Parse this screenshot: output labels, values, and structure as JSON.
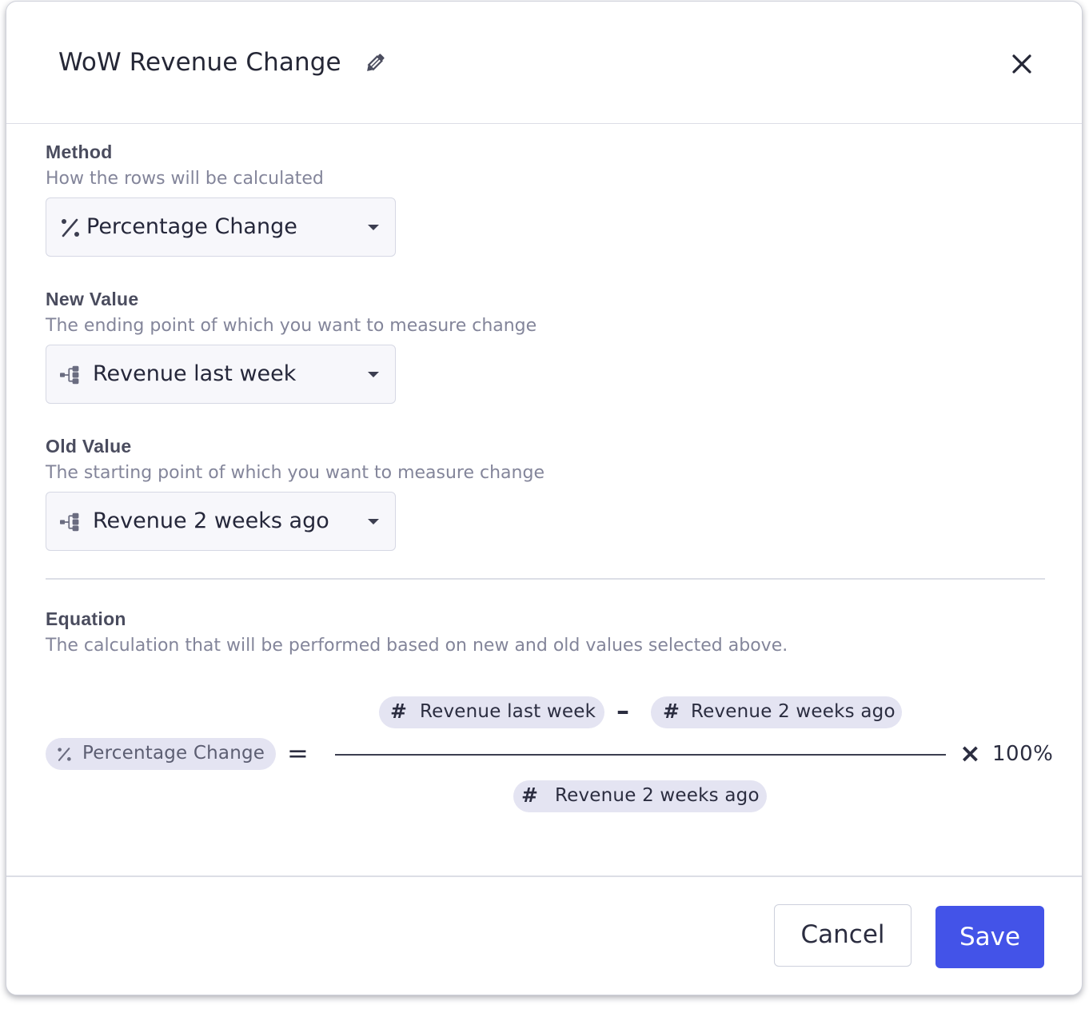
{
  "dialog": {
    "title": "WoW Revenue Change",
    "edit_icon": "pencil-icon",
    "close_icon": "close-icon"
  },
  "method": {
    "label": "Method",
    "description": "How the rows will be calculated",
    "selected": "Percentage Change",
    "icon": "percent-icon"
  },
  "new_value": {
    "label": "New Value",
    "description": "The ending point of which you want to measure change",
    "selected": "Revenue last week",
    "icon": "metric-tree-icon"
  },
  "old_value": {
    "label": "Old Value",
    "description": "The starting point of which you want to measure change",
    "selected": "Revenue 2 weeks ago",
    "icon": "metric-tree-icon"
  },
  "equation": {
    "label": "Equation",
    "description": "The calculation that will be performed based on new and old values selected above.",
    "result_chip": "Percentage Change",
    "equals": "=",
    "numerator_left": "Revenue last week",
    "minus": "–",
    "numerator_right": "Revenue 2 weeks ago",
    "denominator": "Revenue 2 weeks ago",
    "times": "×",
    "multiplier": "100%",
    "number_icon": "#"
  },
  "footer": {
    "cancel_label": "Cancel",
    "save_label": "Save"
  },
  "colors": {
    "accent": "#4353e8",
    "chip_bg": "#e4e4f2",
    "muted_text": "#83859a"
  }
}
